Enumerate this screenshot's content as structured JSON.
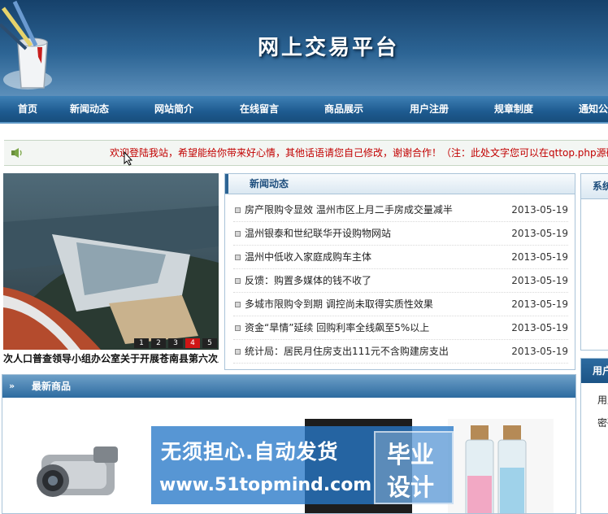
{
  "header": {
    "site_title": "网上交易平台"
  },
  "nav": {
    "items": [
      {
        "label": "首页"
      },
      {
        "label": "新闻动态"
      },
      {
        "label": "网站简介"
      },
      {
        "label": "在线留言"
      },
      {
        "label": "商品展示"
      },
      {
        "label": "用户注册"
      },
      {
        "label": "规章制度"
      },
      {
        "label": "通知公告"
      }
    ]
  },
  "marquee": {
    "text": "欢迎登陆我站，希望能给你带来好心情，其他话语请您自己修改，谢谢合作！（注：此处文字您可以在qttop.php源码中修改）"
  },
  "slideshow": {
    "caption": "次人口普查领导小组办公室关于开展苍南县第六次人口普查",
    "numbers": [
      "1",
      "2",
      "3",
      "4",
      "5"
    ],
    "active_index": 4
  },
  "news": {
    "title": "新闻动态",
    "items": [
      {
        "title": "房产限购令显效 温州市区上月二手房成交量减半",
        "date": "2013-05-19"
      },
      {
        "title": "温州银泰和世纪联华开设购物网站",
        "date": "2013-05-19"
      },
      {
        "title": "温州中低收入家庭成购车主体",
        "date": "2013-05-19"
      },
      {
        "title": "反馈：购置多媒体的钱不收了",
        "date": "2013-05-19"
      },
      {
        "title": "多城市限购令到期 调控尚未取得实质性效果",
        "date": "2013-05-19"
      },
      {
        "title": "资金“旱情”延续 回购利率全线飙至5%以上",
        "date": "2013-05-19"
      },
      {
        "title": "统计局：居民月住房支出111元不含购建房支出",
        "date": "2013-05-19"
      }
    ]
  },
  "sidebar": {
    "box1_title": "系统公告",
    "box2_title": "用户登录",
    "username_label": "用户名",
    "password_label": "密码"
  },
  "products": {
    "title": "最新商品"
  },
  "watermark": {
    "line1": "无须担心.自动发货",
    "line2": "www.51topmind.com",
    "badge1": "毕业",
    "badge2": "设计"
  },
  "colors": {
    "header_bg": "#1e4e7d",
    "nav_bg": "#1e5b90",
    "marquee_text": "#c20000",
    "panel_title": "#1e4e7d",
    "slide_active": "#d01515"
  }
}
